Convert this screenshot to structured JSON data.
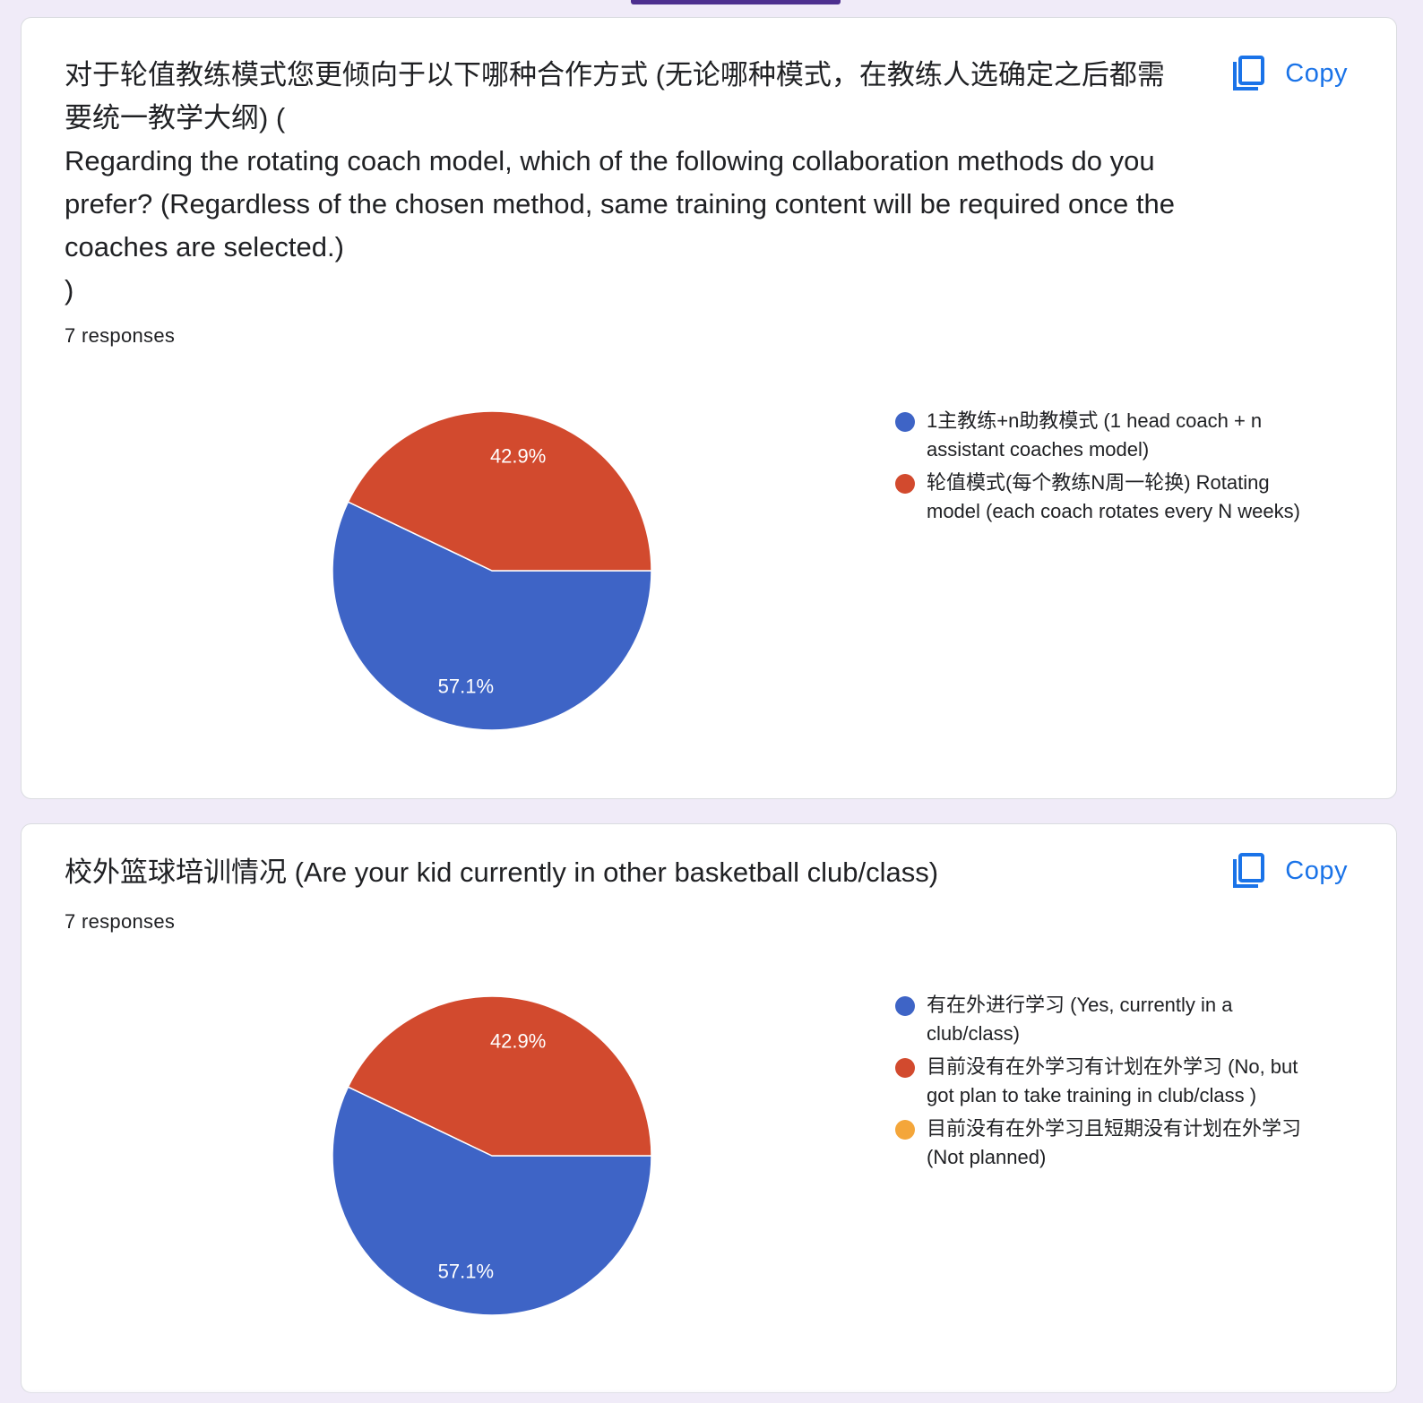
{
  "questions": [
    {
      "title": "对于轮值教练模式您更倾向于以下哪种合作方式 (无论哪种模式，在教练人选确定之后都需要统一教学大纲) (\nRegarding the rotating coach model, which of the following collaboration methods do you prefer? (Regardless of the chosen method, same training content will be required once the coaches are selected.)\n)",
      "responses": "7 responses",
      "copy_label": "Copy",
      "legend": [
        {
          "label": "1主教练+n助教模式 (1 head coach + n assistant coaches model)",
          "color": "#3e64c6"
        },
        {
          "label": "轮值模式(每个教练N周一轮换) Rotating model (each coach rotates every N weeks)",
          "color": "#d24a2e"
        }
      ]
    },
    {
      "title": "校外篮球培训情况 (Are your kid currently in other basketball club/class)",
      "responses": "7 responses",
      "copy_label": "Copy",
      "legend": [
        {
          "label": "有在外进行学习 (Yes, currently in a club/class)",
          "color": "#3e64c6"
        },
        {
          "label": "目前没有在外学习有计划在外学习 (No, but got plan to take training in club/class )",
          "color": "#d24a2e"
        },
        {
          "label": "目前没有在外学习且短期没有计划在外学习 (Not planned)",
          "color": "#f4a63a"
        }
      ]
    }
  ],
  "chart_data": [
    {
      "type": "pie",
      "categories": [
        "1主教练+n助教模式 (1 head coach + n assistant coaches model)",
        "轮值模式(每个教练N周一轮换) Rotating model (each coach rotates every N weeks)"
      ],
      "values": [
        57.1,
        42.9
      ],
      "labels": [
        "57.1%",
        "42.9%"
      ],
      "colors": [
        "#3e64c6",
        "#d24a2e"
      ],
      "legend_position": "right"
    },
    {
      "type": "pie",
      "categories": [
        "有在外进行学习 (Yes, currently in a club/class)",
        "目前没有在外学习有计划在外学习 (No, but got plan to take training in club/class )",
        "目前没有在外学习且短期没有计划在外学习 (Not planned)"
      ],
      "values": [
        57.1,
        42.9,
        0
      ],
      "labels": [
        "57.1%",
        "42.9%",
        ""
      ],
      "colors": [
        "#3e64c6",
        "#d24a2e",
        "#f4a63a"
      ],
      "legend_position": "right"
    }
  ]
}
